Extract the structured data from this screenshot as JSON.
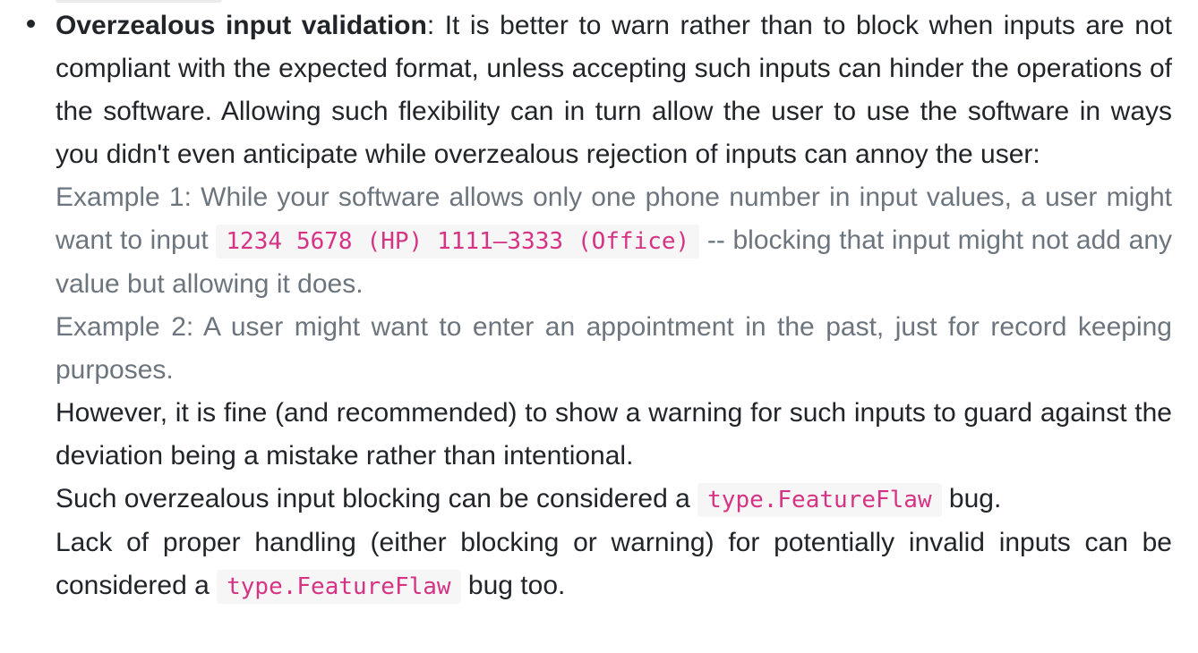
{
  "item": {
    "heading": "Overzealous input validation",
    "intro": ": It is better to warn rather than to block when inputs are not compliant with the expected format, unless accepting such inputs can hinder the operations of the software. Allowing such flexibility can in turn allow the user to use the software in ways you didn't even anticipate while overzealous rejection of inputs can annoy the user:",
    "example1": {
      "text_before": "Example 1: While your software allows only one phone number in input values, a user might want to input ",
      "code": "1234 5678 (HP) 1111–3333 (Office)",
      "text_after": " -- blocking that input might not add any value but allowing it does."
    },
    "example2": "Example 2: A user might want to enter an appointment in the past, just for record keeping purposes.",
    "however": "However, it is fine (and recommended) to show a warning for such inputs to guard against the deviation being a mistake rather than intentional.",
    "feature_flaw_1": {
      "text_before": "Such overzealous input blocking can be considered a ",
      "code": "type.FeatureFlaw",
      "text_after": " bug."
    },
    "feature_flaw_2": {
      "text_before": "Lack of proper handling (either blocking or warning) for potentially invalid inputs can be considered a ",
      "code": "type.FeatureFlaw",
      "text_after": " bug too."
    }
  },
  "colors": {
    "text": "#212529",
    "muted": "#6c757d",
    "code_text": "#d63384",
    "code_background": "#f6f6f7"
  }
}
